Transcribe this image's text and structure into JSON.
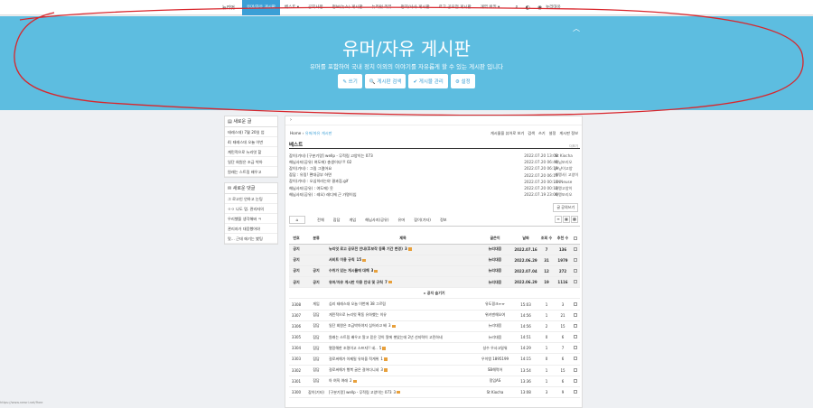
{
  "nav": {
    "logo": "뉴리엇.",
    "items": [
      "유머/자유 게시판",
      "베스트 ▾",
      "공지사항",
      "정보(뉴스) 게시판",
      "뉴리엇 리뷰",
      "정치/사사 게시판",
      "로고 공모전 게시판",
      "개역 위키 ▾"
    ],
    "user": "뉴리대웅"
  },
  "hero": {
    "title": "유머/자유 게시판",
    "subtitle": "유머를 포함하여 국내 정치 이외의 이야기를 자유롭게 할 수 있는 게시판 입니다",
    "buttons": [
      "✎ 쓰기",
      "🔍 게시판 검색",
      "✔ 게시물 관리",
      "⚙ 설정"
    ]
  },
  "sidebar": {
    "new_posts_title": "새로운 글",
    "new_posts": [
      "태레스데) 7월 20일 업",
      "4) 태레스데 오늘 이번",
      "계민적으로 뉴리엇 할",
      "일단 회원은 조금 박아",
      "원래는 스트링 배우고"
    ],
    "new_comments_title": "새로운 댓글",
    "new_comments": [
      "그 로고인 안하고 눈팅",
      "ㅇㅇ 나도 멈. 관리자의",
      "우리했을 생각해봐 ㅋ",
      "관리자가 대응했어야",
      "맛... 근데 애기는 봤팅"
    ]
  },
  "main": {
    "crumb_home": "Home",
    "crumb_board": "유머/자유 게시판",
    "tools": [
      "게시물을 뷰어로 보기",
      "검색",
      "쓰기",
      "설정",
      "게시판 정보"
    ],
    "best_title": "베스트",
    "best_more": "더보기",
    "best": [
      {
        "t": "잡이(기타) [구분기랑] wellp - 무적림 고양이는 073",
        "d": "2022.07.20 13:08",
        "a": "St Kiocha"
      },
      {
        "t": "해님사지(공유) 여도에) 총생이다!!! 02",
        "d": "2022.07.20 06:40",
        "a": "해님또리오"
      },
      {
        "t": "잡이(기타) : 그림 그렸어요",
        "d": "2022.07.20 06:19",
        "a": "JA냥이고양"
      },
      {
        "t": "잡담 : 유링! 편대공부 하면",
        "d": "2022.07.20 06:19",
        "a": "해맹사) 고양이"
      },
      {
        "t": "잡이(기타) : 오심히라는야 결과집.gif",
        "d": "2022.07.20 00:11",
        "a": "ANNeuse"
      },
      {
        "t": "해님사지(공유) : 여도에) 옷",
        "d": "2022.07.20 00:12",
        "a": "해맹고양이"
      },
      {
        "t": "해님사지(공유) : 레오) 레디에 근 가명이임",
        "d": "2022.07.19 23:00",
        "a": "해맹또리오"
      }
    ],
    "write_btn": "글 공의쓰기",
    "cats": [
      "전체",
      "잡담",
      "게임",
      "해님사지(공유)",
      "유머",
      "잡이(기타)",
      "정보"
    ],
    "headers": [
      "번호",
      "분류",
      "제목",
      "글쓴이",
      "날짜",
      "조회 수",
      "추천 수"
    ],
    "rows": [
      {
        "no": "공지",
        "cat": "",
        "title": "뉴리엇 로고 공모전 안내(후보작 등록 기간 변경)",
        "c": "3",
        "author": "뉴리대웅",
        "date": "2022.07.16",
        "v": "7",
        "r": "136",
        "n": true
      },
      {
        "no": "공지",
        "cat": "",
        "title": "서비트 이용 규칙",
        "c": "15",
        "author": "뉴리대웅",
        "date": "2022.06.29",
        "v": "31",
        "r": "1979",
        "n": true
      },
      {
        "no": "공지",
        "cat": "공지",
        "title": "수위가 있는 게시물에 대해",
        "c": "3",
        "author": "뉴리대웅",
        "date": "2022.07.04",
        "v": "12",
        "r": "272",
        "n": true
      },
      {
        "no": "공지",
        "cat": "공지",
        "title": "유머/자유 게시판 이용 안내 및 규칙",
        "c": "7",
        "author": "뉴리대웅",
        "date": "2022.06.29",
        "v": "19",
        "r": "1116",
        "n": true
      },
      {
        "no": "",
        "cat": "",
        "title": "▸ 공지 숨기기",
        "c": "",
        "author": "",
        "date": "",
        "v": "",
        "r": "",
        "hide": true
      },
      {
        "no": "3308",
        "cat": "게임",
        "title": "심리 테레스대 오늘 이번에 38 그르림",
        "c": "",
        "author": "유도핑크ㅠㅠ",
        "date": "15:03",
        "v": "1",
        "r": "3"
      },
      {
        "no": "3307",
        "cat": "잡담",
        "title": "게민적으로 뉴리엇 확동 유하했는 이유",
        "c": "",
        "author": "위키맨해오여",
        "date": "14:56",
        "v": "1",
        "r": "21"
      },
      {
        "no": "3306",
        "cat": "잡담",
        "title": "일단 회원은 조금박아야지 심어라고 배",
        "c": "3",
        "author": "뉴리대웅",
        "date": "14:56",
        "v": "2",
        "r": "15"
      },
      {
        "no": "3305",
        "cat": "잡담",
        "title": "원래는 스트링 배우고 알고 믿은 것이 알에 쌓았는데 2년 선지력이 고민하네",
        "c": "",
        "author": "뉴리대웅",
        "date": "14:51",
        "v": "0",
        "r": "6"
      },
      {
        "no": "3304",
        "cat": "잡담",
        "title": "멸망해한 조명이고 스프지!! 네..",
        "c": "5",
        "author": "성수 우사고밀워",
        "date": "14:29",
        "v": "1",
        "r": "7"
      },
      {
        "no": "3303",
        "cat": "잡담",
        "title": "걸로써해가 아제밀 유처을 적게위",
        "c": "1",
        "author": "우이앵 1895199",
        "date": "14:15",
        "v": "0",
        "r": "6"
      },
      {
        "no": "3302",
        "cat": "잡담",
        "title": "걸로써해가 행복 굴은 걸어다니네",
        "c": "3",
        "author": "SB해먹어",
        "date": "13:54",
        "v": "1",
        "r": "15"
      },
      {
        "no": "3301",
        "cat": "잡담",
        "title": "아 여직 여래",
        "c": "2",
        "author": "정임AS",
        "date": "13:36",
        "v": "1",
        "r": "6"
      },
      {
        "no": "3300",
        "cat": "잡이(기타)",
        "title": "[구분기랑] wellp - 무적림 고양이는 073",
        "c": "3",
        "author": "St Kiocha",
        "date": "13:08",
        "v": "3",
        "r": "9"
      }
    ]
  },
  "status": "https://www.newri.net/fhee"
}
